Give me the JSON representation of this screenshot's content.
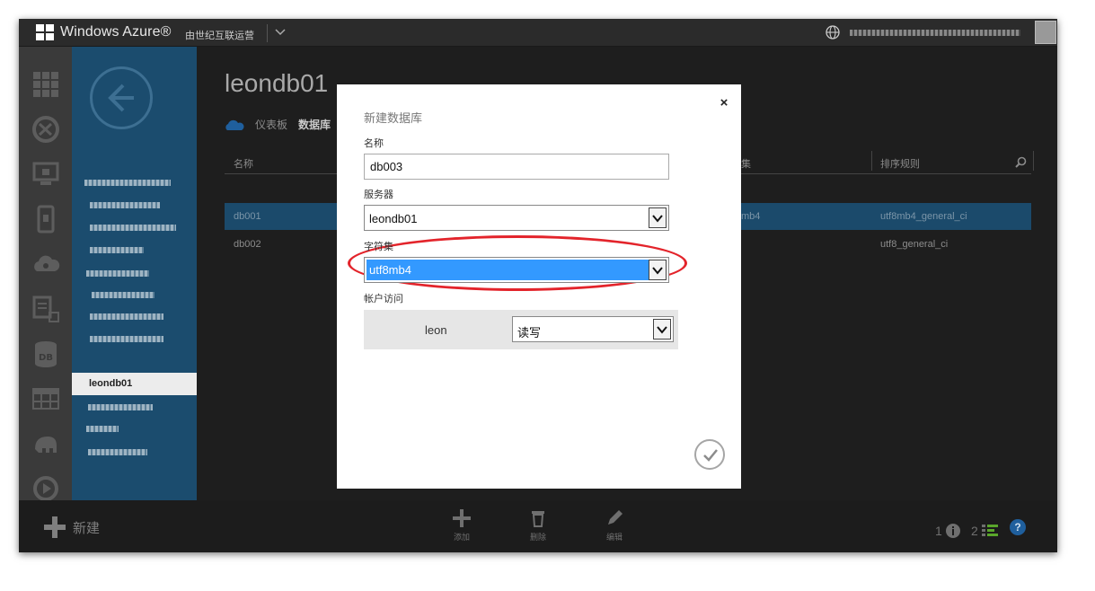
{
  "topbar": {
    "brand": "Windows Azure®",
    "subscription": "由世纪互联运营"
  },
  "nav": {
    "selected_item": "leondb01"
  },
  "main": {
    "title": "leondb01",
    "tabs": [
      "仪表板",
      "数据库"
    ],
    "columns": {
      "name": "名称",
      "charset": "集",
      "collation": "排序规则"
    },
    "rows": [
      {
        "name": "db001",
        "charset": "mb4",
        "collation": "utf8mb4_general_ci"
      },
      {
        "name": "db002",
        "charset": "",
        "collation": "utf8_general_ci"
      }
    ]
  },
  "bottombar": {
    "new_label": "新建",
    "add_label": "添加",
    "delete_label": "删除",
    "edit_label": "编辑",
    "count1": "1",
    "count2": "2",
    "help": "?"
  },
  "modal": {
    "title": "新建数据库",
    "close": "×",
    "name_label": "名称",
    "name_value": "db003",
    "server_label": "服务器",
    "server_value": "leondb01",
    "charset_label": "字符集",
    "charset_value": "utf8mb4",
    "access_label": "帐户访问",
    "access_user": "leon",
    "access_value": "读写"
  },
  "colors": {
    "nav_bg": "#1b4c6e",
    "selection_blue": "#3399ff",
    "annotation_red": "#e3242b"
  }
}
